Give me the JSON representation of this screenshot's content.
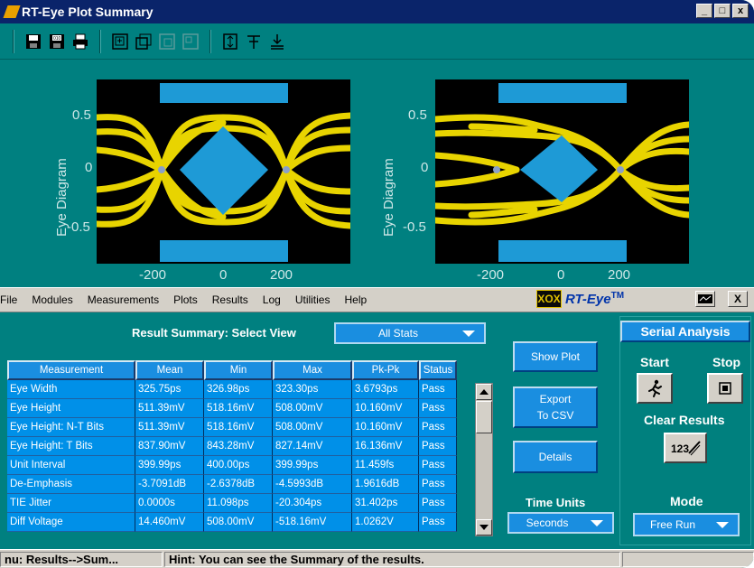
{
  "window": {
    "title": "RT-Eye Plot Summary",
    "minimize": "_",
    "maximize": "□",
    "close": "x"
  },
  "toolbar": {
    "icons": [
      "save-icon",
      "save-as-icon",
      "print-icon",
      "zoom-in-icon",
      "zoom-out-icon",
      "zoom-box-icon",
      "zoom-fit-icon",
      "cursor-icon",
      "marker-icon",
      "baseline-icon"
    ]
  },
  "plots": [
    {
      "y_title": "Eye Diagram",
      "y_ticks": [
        "0.5",
        "0",
        "-0.5"
      ],
      "x_ticks": [
        "-200",
        "0",
        "200"
      ]
    },
    {
      "y_title": "Eye Diagram",
      "y_ticks": [
        "0.5",
        "0",
        "-0.5"
      ],
      "x_ticks": [
        "-200",
        "0",
        "200"
      ]
    }
  ],
  "menu": {
    "items": [
      "File",
      "Modules",
      "Measurements",
      "Plots",
      "Results",
      "Log",
      "Utilities",
      "Help"
    ],
    "brand_logo": "XOX",
    "brand_text": "RT-Eye",
    "brand_tm": "TM",
    "close": "X"
  },
  "summary": {
    "title": "Result Summary: Select View",
    "view_value": "All Stats",
    "columns": [
      "Measurement",
      "Mean",
      "Min",
      "Max",
      "Pk-Pk",
      "Status"
    ],
    "rows": [
      [
        "Eye Width",
        "325.75ps",
        "326.98ps",
        "323.30ps",
        "3.6793ps",
        "Pass"
      ],
      [
        "Eye Height",
        "511.39mV",
        "518.16mV",
        "508.00mV",
        "10.160mV",
        "Pass"
      ],
      [
        "Eye Height: N-T Bits",
        "511.39mV",
        "518.16mV",
        "508.00mV",
        "10.160mV",
        "Pass"
      ],
      [
        "Eye Height: T Bits",
        "837.90mV",
        "843.28mV",
        "827.14mV",
        "16.136mV",
        "Pass"
      ],
      [
        "Unit Interval",
        "399.99ps",
        "400.00ps",
        "399.99ps",
        "11.459fs",
        "Pass"
      ],
      [
        "De-Emphasis",
        "-3.7091dB",
        "-2.6378dB",
        "-4.5993dB",
        "1.9616dB",
        "Pass"
      ],
      [
        "TIE Jitter",
        "0.0000s",
        "11.098ps",
        "-20.304ps",
        "31.402ps",
        "Pass"
      ],
      [
        "Diff Voltage",
        "14.460mV",
        "508.00mV",
        "-518.16mV",
        "1.0262V",
        "Pass"
      ]
    ]
  },
  "actions": {
    "show_plot": "Show Plot",
    "export_line1": "Export",
    "export_line2": "To CSV",
    "details": "Details",
    "time_units_label": "Time Units",
    "time_units_value": "Seconds"
  },
  "serial": {
    "title": "Serial Analysis",
    "start": "Start",
    "stop": "Stop",
    "clear_results": "Clear Results",
    "mode_label": "Mode",
    "mode_value": "Free Run"
  },
  "status": {
    "menu_path": "nu: Results-->Sum...",
    "hint": "Hint: You can see the Summary of the results."
  },
  "colors": {
    "teal": "#008080",
    "accent_blue": "#1a8ee0",
    "trace_yellow": "#f5e000",
    "mask_blue": "#1e9ad6"
  }
}
